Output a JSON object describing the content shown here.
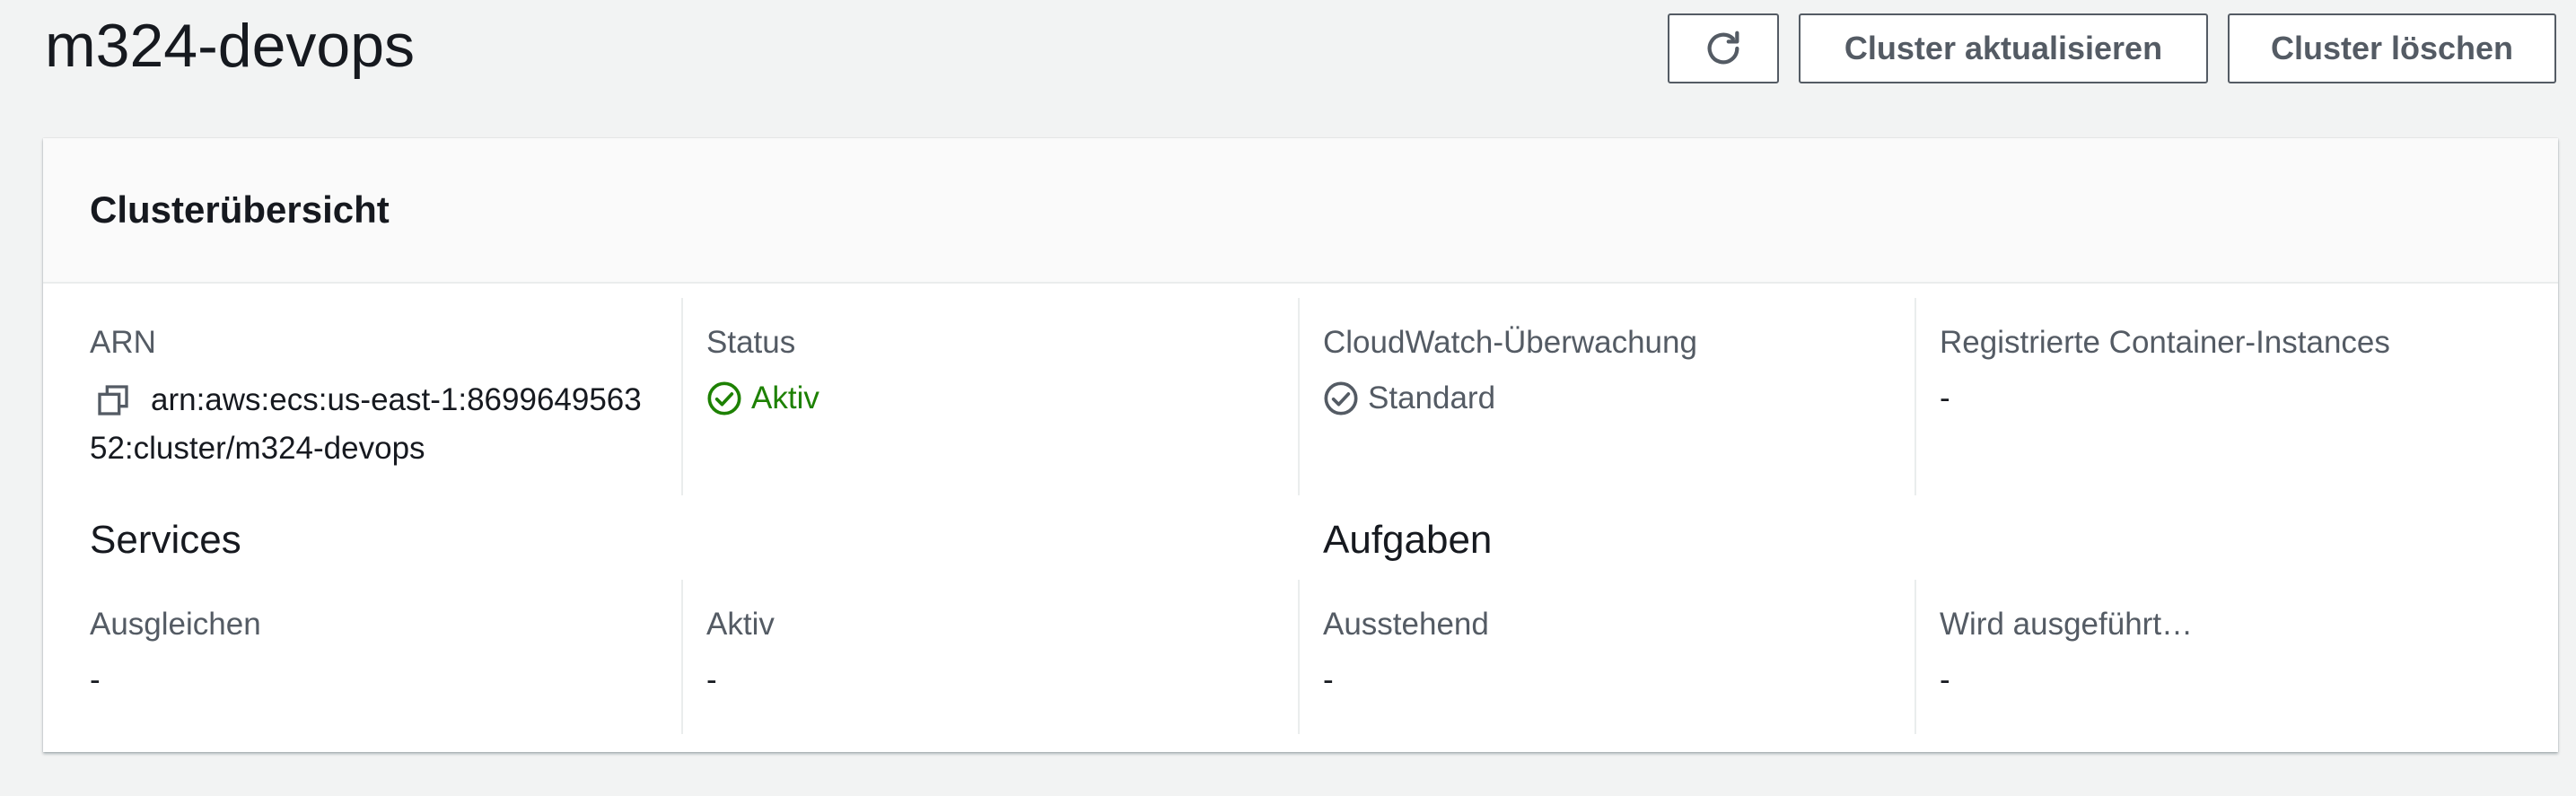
{
  "page": {
    "title": "m324-devops"
  },
  "actions": {
    "refresh_icon": "refresh-icon",
    "update_label": "Cluster aktualisieren",
    "delete_label": "Cluster löschen"
  },
  "overview": {
    "title": "Clusterübersicht",
    "arn": {
      "label": "ARN",
      "value_line1": "arn:aws:ecs:us-east-1:8699649563",
      "value_line2": "52:cluster/m324-devops",
      "icon": "copy-icon"
    },
    "status": {
      "label": "Status",
      "value": "Aktiv",
      "color": "#1d8102",
      "icon": "check-circle-icon"
    },
    "cloudwatch": {
      "label": "CloudWatch-Überwachung",
      "value": "Standard",
      "color": "#545b64",
      "icon": "check-circle-icon"
    },
    "container_instances": {
      "label": "Registrierte Container-Instances",
      "value": "-"
    }
  },
  "services": {
    "title": "Services",
    "balancing": {
      "label": "Ausgleichen",
      "value": "-"
    },
    "active": {
      "label": "Aktiv",
      "value": "-"
    }
  },
  "tasks": {
    "title": "Aufgaben",
    "pending": {
      "label": "Ausstehend",
      "value": "-"
    },
    "running": {
      "label": "Wird ausgeführt…",
      "value": "-"
    }
  }
}
